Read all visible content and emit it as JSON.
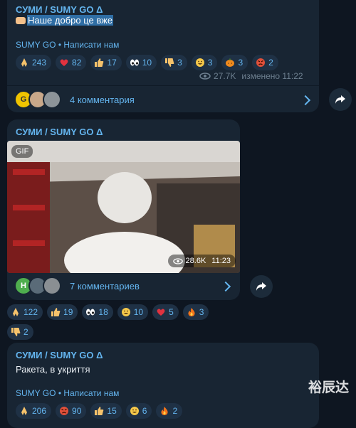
{
  "post1": {
    "channel": "СУМИ / SUMY GO Δ",
    "text": "Наше добро це вже",
    "footer_channel": "SUMY GO",
    "footer_link": "Написати нам",
    "reactions": [
      {
        "icon": "pray-icon",
        "count": "243"
      },
      {
        "icon": "heart-icon",
        "count": "82"
      },
      {
        "icon": "thumbs-up-icon",
        "count": "17"
      },
      {
        "icon": "eyes-icon",
        "count": "10"
      },
      {
        "icon": "thumbs-down-icon",
        "count": "3"
      },
      {
        "icon": "grin-icon",
        "count": "3"
      },
      {
        "icon": "pumpkin-icon",
        "count": "3"
      },
      {
        "icon": "angry-face-icon",
        "count": "2"
      }
    ],
    "views": "27.7K",
    "edited": "изменено 11:22",
    "comments": "4 комментария"
  },
  "post2": {
    "channel": "СУМИ / SUMY GO Δ",
    "gif_label": "GIF",
    "video_views": "28.6K",
    "video_time": "11:23",
    "comments": "7 комментариев",
    "reactions": [
      {
        "icon": "pray-icon",
        "count": "122"
      },
      {
        "icon": "thumbs-up-icon",
        "count": "19"
      },
      {
        "icon": "eyes-icon",
        "count": "18"
      },
      {
        "icon": "grin-icon",
        "count": "10"
      },
      {
        "icon": "heart-icon",
        "count": "5"
      },
      {
        "icon": "fire-icon",
        "count": "3"
      },
      {
        "icon": "thumbs-down-icon",
        "count": "2"
      }
    ]
  },
  "post3": {
    "channel": "СУМИ / SUMY GO Δ",
    "text": "Ракета, в укриття",
    "footer_channel": "SUMY GO",
    "footer_link": "Написати нам",
    "reactions": [
      {
        "icon": "pray-icon",
        "count": "206"
      },
      {
        "icon": "angry-face-icon",
        "count": "90"
      },
      {
        "icon": "thumbs-up-icon",
        "count": "15"
      },
      {
        "icon": "grin-icon",
        "count": "6"
      },
      {
        "icon": "fire-icon",
        "count": "2"
      }
    ]
  },
  "watermark": "裕辰达",
  "colors": {
    "background": "#0e1621",
    "bubble": "#182533",
    "accent": "#64b5ef"
  }
}
